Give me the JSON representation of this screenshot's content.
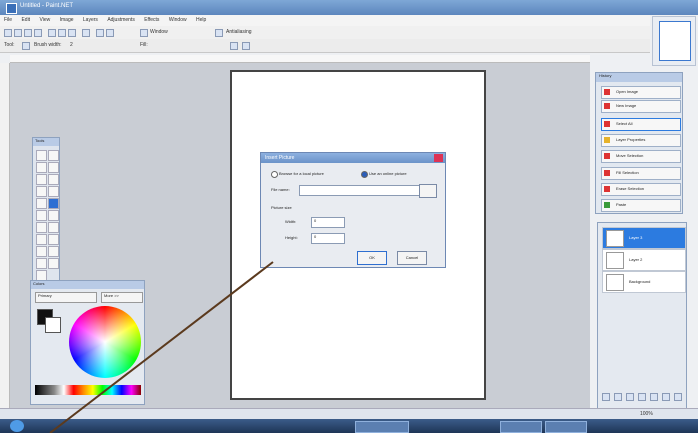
{
  "window": {
    "title": "Untitled - Paint.NET"
  },
  "menu": [
    "File",
    "Edit",
    "View",
    "Image",
    "Layers",
    "Adjustments",
    "Effects",
    "Window",
    "Help"
  ],
  "toolbar": {
    "window_label": "Window",
    "antialias_label": "Antialiasing",
    "tool_label": "Tool:",
    "fill_label": "Fill:",
    "brush_width_label": "Brush width:",
    "brush_width_value": "2"
  },
  "dialog": {
    "title": "Insert Picture",
    "radio_file": "Browse for a local picture",
    "radio_url": "Use an online picture",
    "file_label": "File name:",
    "file_value": "",
    "size_group": "Picture size",
    "width_label": "Width:",
    "width_value": "0",
    "height_label": "Height:",
    "height_value": "0",
    "ok": "OK",
    "cancel": "Cancel"
  },
  "tools": {
    "title": "Tools"
  },
  "colors": {
    "title": "Colors",
    "primary_label": "Primary",
    "more_label": "More >>"
  },
  "history": {
    "title": "History",
    "items": [
      "Open Image",
      "New Image",
      "Select All",
      "Layer Properties",
      "Move Selection",
      "Fill Selection",
      "Erase Selection",
      "Paste"
    ]
  },
  "layers": {
    "items": [
      "Layer 3",
      "Layer 2",
      "Background"
    ]
  },
  "statusbar": {
    "text": "",
    "zoom": "100%"
  },
  "colors_meta": {
    "accent": "#2c7be0",
    "title_bar": "#5c86bd",
    "taskbar": "#1e3556",
    "annotation_line": "#5b3a1e"
  }
}
